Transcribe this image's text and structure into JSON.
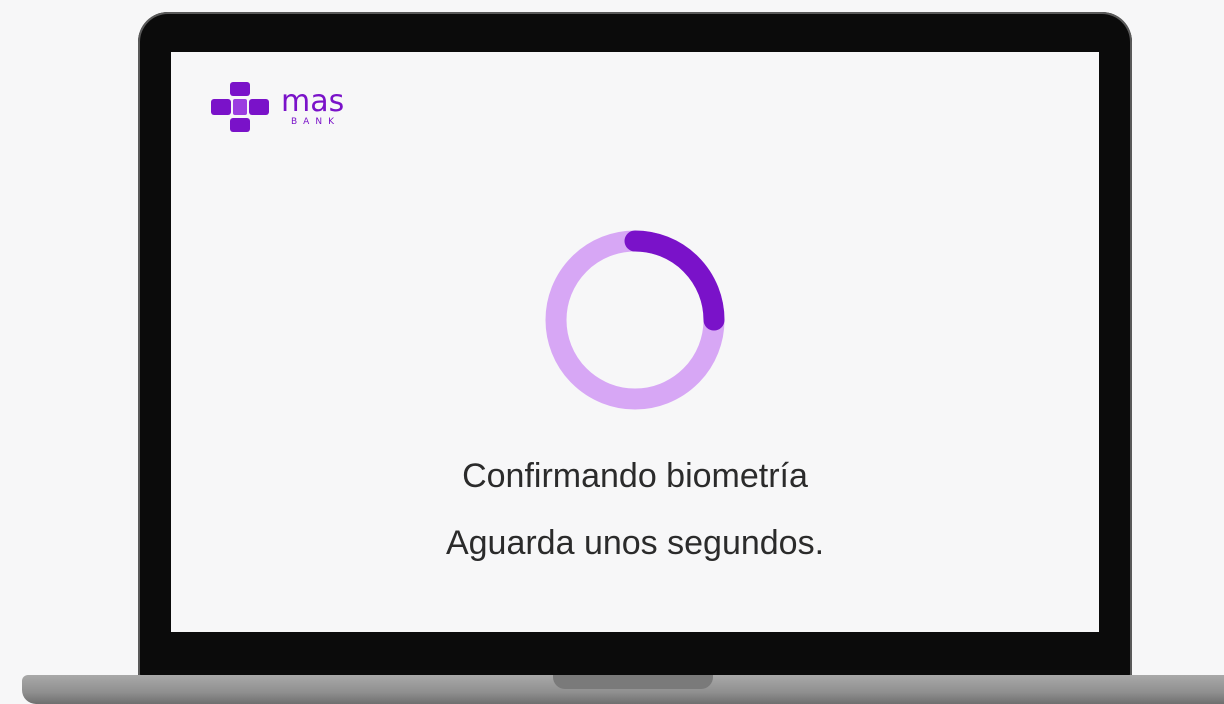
{
  "brand": {
    "name": "mas",
    "sub": "BANK",
    "color": "#7a12c9"
  },
  "loader": {
    "progress": 0.25,
    "track_color": "#d7a7f5",
    "fill_color": "#7a12c9"
  },
  "status": {
    "title": "Confirmando biometría",
    "subtitle": "Aguarda unos segundos."
  }
}
